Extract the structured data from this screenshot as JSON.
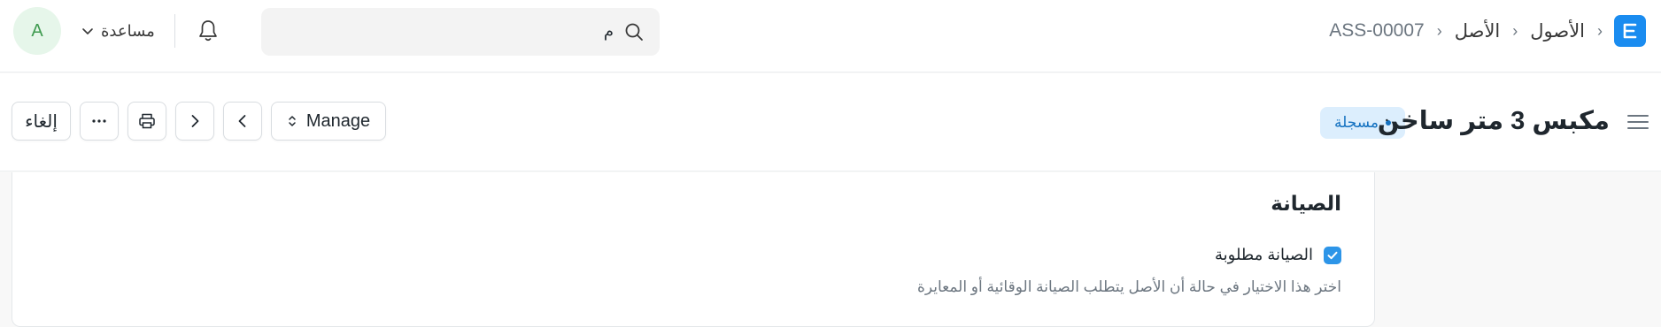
{
  "navbar": {
    "avatar_initial": "A",
    "help_label": "مساعدة",
    "search_value": "م",
    "breadcrumbs": [
      "الأصول",
      "الأصل",
      "ASS-00007"
    ],
    "crumb_separator": "›",
    "logo_letter": "E"
  },
  "page": {
    "title": "مكبس 3 متر ساخن",
    "status": "مسجلة",
    "buttons": {
      "cancel": "إلغاء",
      "more": "···",
      "manage": "Manage"
    }
  },
  "form": {
    "section_title": "الصيانة",
    "maintenance_required_label": "الصيانة مطلوبة",
    "maintenance_required_checked": true,
    "help_text": "اختر هذا الاختيار في حالة أن الأصل يتطلب الصيانة الوقائية أو المعايرة"
  },
  "colors": {
    "accent": "#1a8cf0",
    "badge_bg": "#dceefd",
    "badge_text": "#1572c1",
    "avatar_bg": "#e6f6ea",
    "avatar_text": "#3f9b50"
  }
}
